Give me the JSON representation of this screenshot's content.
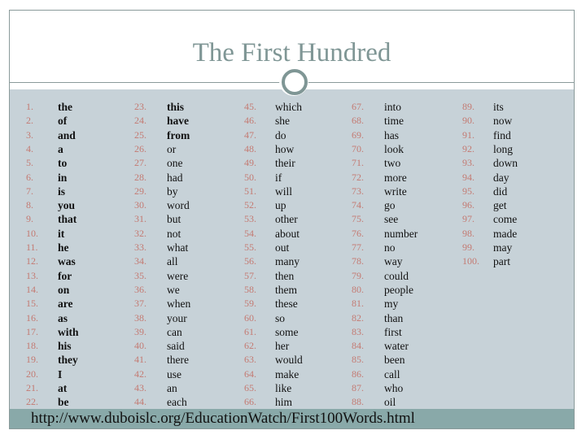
{
  "title": "The First Hundred",
  "footer_url": "http://www.duboislc.org/EducationWatch/First100Words.html",
  "colors": {
    "title": "#7f9695",
    "number": "#c47a72",
    "content_bg": "#c7d2d8",
    "footer_bg": "#89a9a9"
  },
  "bold_through": 25,
  "words": [
    "the",
    "of",
    "and",
    "a",
    "to",
    "in",
    "is",
    "you",
    "that",
    "it",
    "he",
    "was",
    "for",
    "on",
    "are",
    "as",
    "with",
    "his",
    "they",
    "I",
    "at",
    "be",
    "this",
    "have",
    "from",
    "or",
    "one",
    "had",
    "by",
    "word",
    "but",
    "not",
    "what",
    "all",
    "were",
    "we",
    "when",
    "your",
    "can",
    "said",
    "there",
    "use",
    "an",
    "each",
    "which",
    "she",
    "do",
    "how",
    "their",
    "if",
    "will",
    "up",
    "other",
    "about",
    "out",
    "many",
    "then",
    "them",
    "these",
    "so",
    "some",
    "her",
    "would",
    "make",
    "like",
    "him",
    "into",
    "time",
    "has",
    "look",
    "two",
    "more",
    "write",
    "go",
    "see",
    "number",
    "no",
    "way",
    "could",
    "people",
    "my",
    "than",
    "first",
    "water",
    "been",
    "call",
    "who",
    "oil",
    "its",
    "now",
    "find",
    "long",
    "down",
    "day",
    "did",
    "get",
    "come",
    "made",
    "may",
    "part"
  ]
}
